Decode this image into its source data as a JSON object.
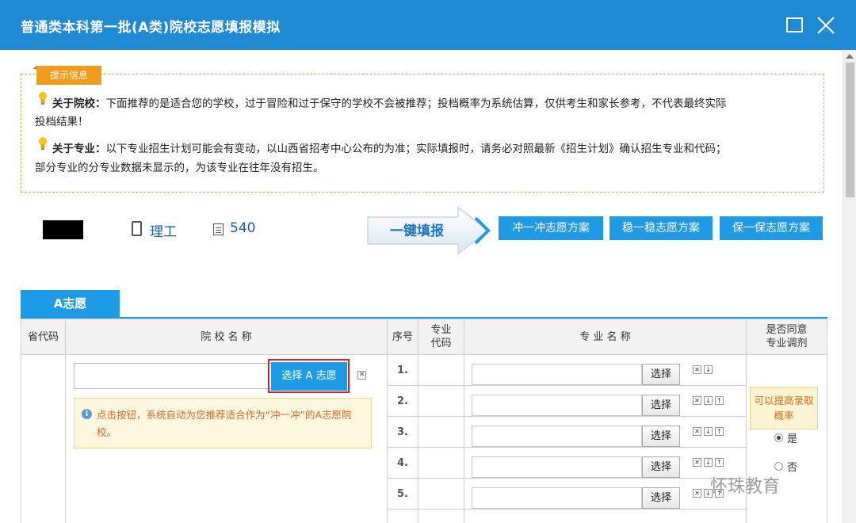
{
  "window": {
    "title": "普通类本科第一批(A类)院校志愿填报模拟"
  },
  "notice": {
    "tag": "提示信息",
    "school_label": "关于院校：",
    "school_text": "下面推荐的是适合您的学校，过于冒险和过于保守的学校不会被推荐；投档概率为系统估算，仅供考生和家长参考，不代表最终实际",
    "school_text_2": "投档结果！",
    "major_label": "关于专业：",
    "major_text": "以下专业招生计划可能会有变动，以山西省招考中心公布的为准；实际填报时，请务必对照最新《招生计划》确认招生专业和代码；",
    "major_text_2": "部分专业的分专业数据未显示的，为该专业在往年没有招生。"
  },
  "student": {
    "category": "理工",
    "score": "540"
  },
  "actions": {
    "one_click": "一键填报",
    "plan_rush": "冲一冲志愿方案",
    "plan_steady": "稳一稳志愿方案",
    "plan_safe": "保一保志愿方案"
  },
  "tab": {
    "label": "A志愿"
  },
  "table": {
    "headers": {
      "province_code": "省代码",
      "school_name": "院 校 名 称",
      "seq": "序号",
      "major_code_1": "专业",
      "major_code_2": "代码",
      "major_name": "专 业 名 称",
      "adjust_1": "是否同意",
      "adjust_2": "专业调剂"
    },
    "school_input_value": "",
    "select_a_button": "选择 A 志愿",
    "hint": "点击按钮，系统自动为您推荐适合作为“冲一冲”的A志愿院校。",
    "rows": [
      {
        "seq": "1.",
        "choose": "选择"
      },
      {
        "seq": "2.",
        "choose": "选择"
      },
      {
        "seq": "3.",
        "choose": "选择"
      },
      {
        "seq": "4.",
        "choose": "选择"
      },
      {
        "seq": "5.",
        "choose": "选择"
      }
    ],
    "probability_hint": "可以提高录取概率",
    "adjust_yes": "是",
    "adjust_no": "否"
  },
  "watermark": "怀珠教育",
  "colors": {
    "titlebar": "#1f8ad4",
    "button": "#1e9be6",
    "notice_tag": "#f29c1f",
    "hint_text": "#e0662a"
  }
}
